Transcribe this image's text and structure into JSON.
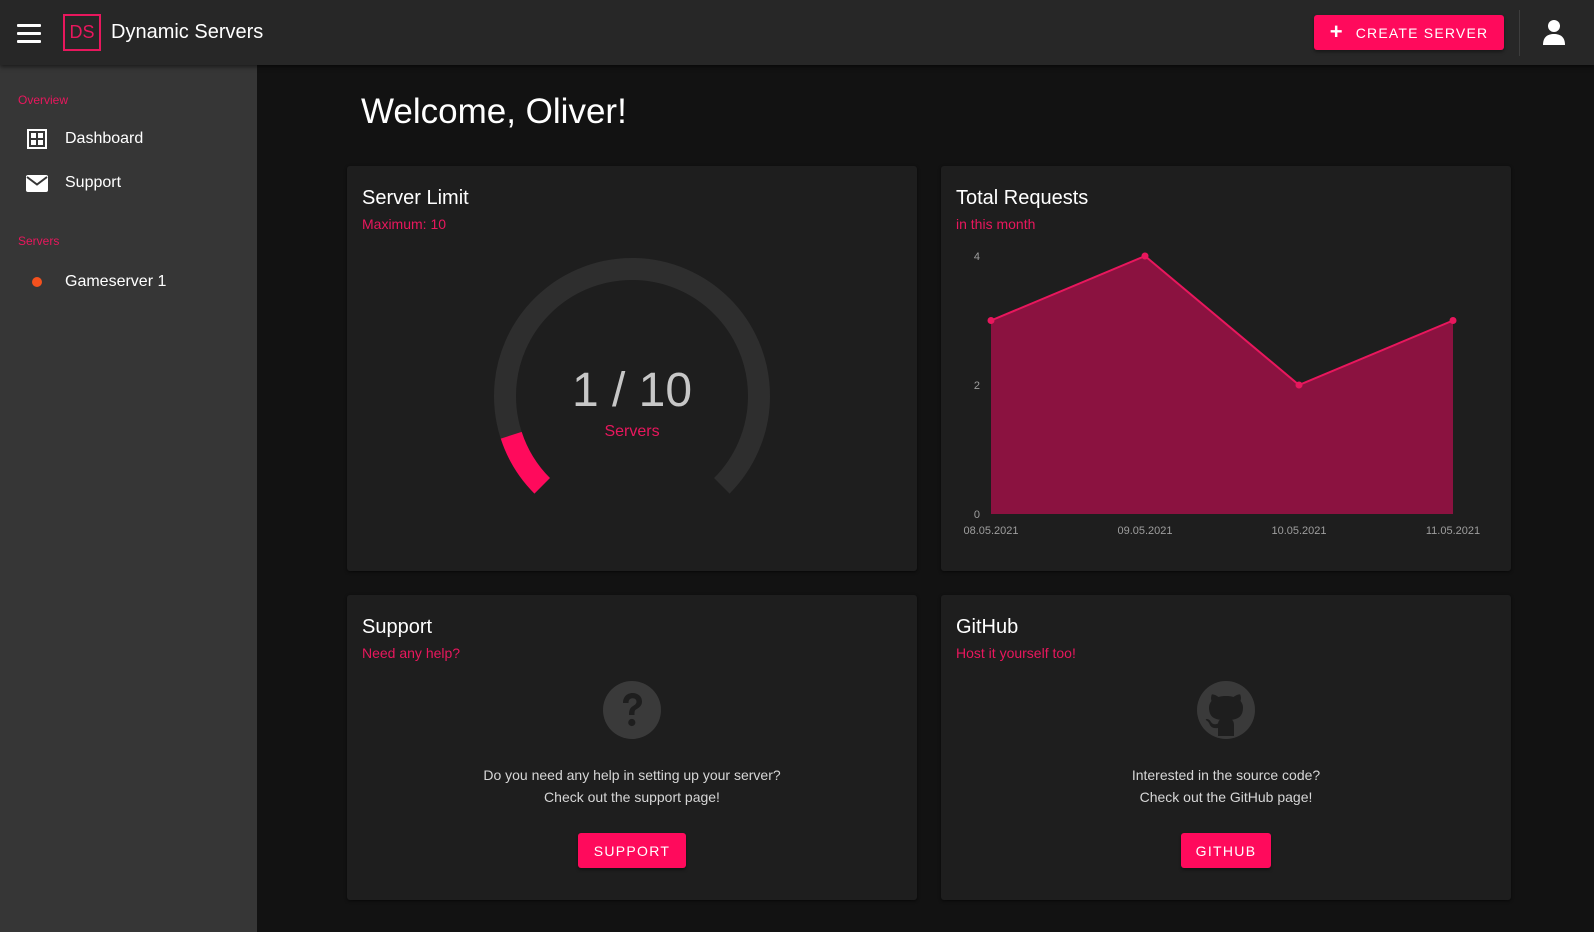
{
  "app": {
    "logo_text": "DS",
    "title": "Dynamic Servers",
    "create_button": "CREATE SERVER",
    "accent_color": "#ff0a5c"
  },
  "sidebar": {
    "overview_title": "Overview",
    "overview_items": [
      {
        "label": "Dashboard",
        "icon": "dashboard-grid-icon"
      },
      {
        "label": "Support",
        "icon": "envelope-icon"
      }
    ],
    "servers_title": "Servers",
    "servers": [
      {
        "label": "Gameserver 1",
        "status_color": "#f4511e"
      }
    ]
  },
  "main": {
    "welcome": "Welcome, Oliver!",
    "server_limit": {
      "title": "Server Limit",
      "subtitle": "Maximum: 10",
      "value_text": "1 / 10",
      "unit": "Servers",
      "used": 1,
      "max": 10
    },
    "total_requests": {
      "title": "Total Requests",
      "subtitle": "in this month"
    },
    "support": {
      "title": "Support",
      "subtitle": "Need any help?",
      "line1": "Do you need any help in setting up your server?",
      "line2": "Check out the support page!",
      "button": "SUPPORT",
      "icon": "question-circle-icon"
    },
    "github": {
      "title": "GitHub",
      "subtitle": "Host it yourself too!",
      "line1": "Interested in the source code?",
      "line2": "Check out the GitHub page!",
      "button": "GITHUB",
      "icon": "github-icon"
    }
  },
  "chart_data": {
    "type": "area",
    "title": "Total Requests",
    "subtitle": "in this month",
    "x": [
      "08.05.2021",
      "09.05.2021",
      "10.05.2021",
      "11.05.2021"
    ],
    "series": [
      {
        "values": [
          3,
          4,
          2,
          3
        ]
      }
    ],
    "yticks": [
      0,
      2,
      4
    ],
    "ylim": [
      0,
      4
    ],
    "xlabel": "",
    "ylabel": "",
    "grid": false,
    "line_color": "#e8175d",
    "fill_color": "#8b1240"
  }
}
